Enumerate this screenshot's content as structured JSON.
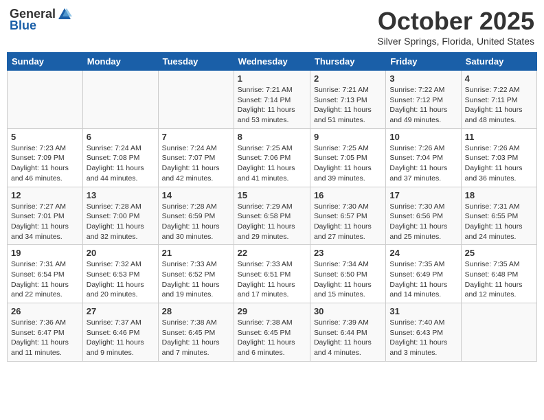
{
  "header": {
    "logo_general": "General",
    "logo_blue": "Blue",
    "month": "October 2025",
    "location": "Silver Springs, Florida, United States"
  },
  "days_of_week": [
    "Sunday",
    "Monday",
    "Tuesday",
    "Wednesday",
    "Thursday",
    "Friday",
    "Saturday"
  ],
  "weeks": [
    [
      {
        "day": "",
        "info": ""
      },
      {
        "day": "",
        "info": ""
      },
      {
        "day": "",
        "info": ""
      },
      {
        "day": "1",
        "info": "Sunrise: 7:21 AM\nSunset: 7:14 PM\nDaylight: 11 hours and 53 minutes."
      },
      {
        "day": "2",
        "info": "Sunrise: 7:21 AM\nSunset: 7:13 PM\nDaylight: 11 hours and 51 minutes."
      },
      {
        "day": "3",
        "info": "Sunrise: 7:22 AM\nSunset: 7:12 PM\nDaylight: 11 hours and 49 minutes."
      },
      {
        "day": "4",
        "info": "Sunrise: 7:22 AM\nSunset: 7:11 PM\nDaylight: 11 hours and 48 minutes."
      }
    ],
    [
      {
        "day": "5",
        "info": "Sunrise: 7:23 AM\nSunset: 7:09 PM\nDaylight: 11 hours and 46 minutes."
      },
      {
        "day": "6",
        "info": "Sunrise: 7:24 AM\nSunset: 7:08 PM\nDaylight: 11 hours and 44 minutes."
      },
      {
        "day": "7",
        "info": "Sunrise: 7:24 AM\nSunset: 7:07 PM\nDaylight: 11 hours and 42 minutes."
      },
      {
        "day": "8",
        "info": "Sunrise: 7:25 AM\nSunset: 7:06 PM\nDaylight: 11 hours and 41 minutes."
      },
      {
        "day": "9",
        "info": "Sunrise: 7:25 AM\nSunset: 7:05 PM\nDaylight: 11 hours and 39 minutes."
      },
      {
        "day": "10",
        "info": "Sunrise: 7:26 AM\nSunset: 7:04 PM\nDaylight: 11 hours and 37 minutes."
      },
      {
        "day": "11",
        "info": "Sunrise: 7:26 AM\nSunset: 7:03 PM\nDaylight: 11 hours and 36 minutes."
      }
    ],
    [
      {
        "day": "12",
        "info": "Sunrise: 7:27 AM\nSunset: 7:01 PM\nDaylight: 11 hours and 34 minutes."
      },
      {
        "day": "13",
        "info": "Sunrise: 7:28 AM\nSunset: 7:00 PM\nDaylight: 11 hours and 32 minutes."
      },
      {
        "day": "14",
        "info": "Sunrise: 7:28 AM\nSunset: 6:59 PM\nDaylight: 11 hours and 30 minutes."
      },
      {
        "day": "15",
        "info": "Sunrise: 7:29 AM\nSunset: 6:58 PM\nDaylight: 11 hours and 29 minutes."
      },
      {
        "day": "16",
        "info": "Sunrise: 7:30 AM\nSunset: 6:57 PM\nDaylight: 11 hours and 27 minutes."
      },
      {
        "day": "17",
        "info": "Sunrise: 7:30 AM\nSunset: 6:56 PM\nDaylight: 11 hours and 25 minutes."
      },
      {
        "day": "18",
        "info": "Sunrise: 7:31 AM\nSunset: 6:55 PM\nDaylight: 11 hours and 24 minutes."
      }
    ],
    [
      {
        "day": "19",
        "info": "Sunrise: 7:31 AM\nSunset: 6:54 PM\nDaylight: 11 hours and 22 minutes."
      },
      {
        "day": "20",
        "info": "Sunrise: 7:32 AM\nSunset: 6:53 PM\nDaylight: 11 hours and 20 minutes."
      },
      {
        "day": "21",
        "info": "Sunrise: 7:33 AM\nSunset: 6:52 PM\nDaylight: 11 hours and 19 minutes."
      },
      {
        "day": "22",
        "info": "Sunrise: 7:33 AM\nSunset: 6:51 PM\nDaylight: 11 hours and 17 minutes."
      },
      {
        "day": "23",
        "info": "Sunrise: 7:34 AM\nSunset: 6:50 PM\nDaylight: 11 hours and 15 minutes."
      },
      {
        "day": "24",
        "info": "Sunrise: 7:35 AM\nSunset: 6:49 PM\nDaylight: 11 hours and 14 minutes."
      },
      {
        "day": "25",
        "info": "Sunrise: 7:35 AM\nSunset: 6:48 PM\nDaylight: 11 hours and 12 minutes."
      }
    ],
    [
      {
        "day": "26",
        "info": "Sunrise: 7:36 AM\nSunset: 6:47 PM\nDaylight: 11 hours and 11 minutes."
      },
      {
        "day": "27",
        "info": "Sunrise: 7:37 AM\nSunset: 6:46 PM\nDaylight: 11 hours and 9 minutes."
      },
      {
        "day": "28",
        "info": "Sunrise: 7:38 AM\nSunset: 6:45 PM\nDaylight: 11 hours and 7 minutes."
      },
      {
        "day": "29",
        "info": "Sunrise: 7:38 AM\nSunset: 6:45 PM\nDaylight: 11 hours and 6 minutes."
      },
      {
        "day": "30",
        "info": "Sunrise: 7:39 AM\nSunset: 6:44 PM\nDaylight: 11 hours and 4 minutes."
      },
      {
        "day": "31",
        "info": "Sunrise: 7:40 AM\nSunset: 6:43 PM\nDaylight: 11 hours and 3 minutes."
      },
      {
        "day": "",
        "info": ""
      }
    ]
  ]
}
